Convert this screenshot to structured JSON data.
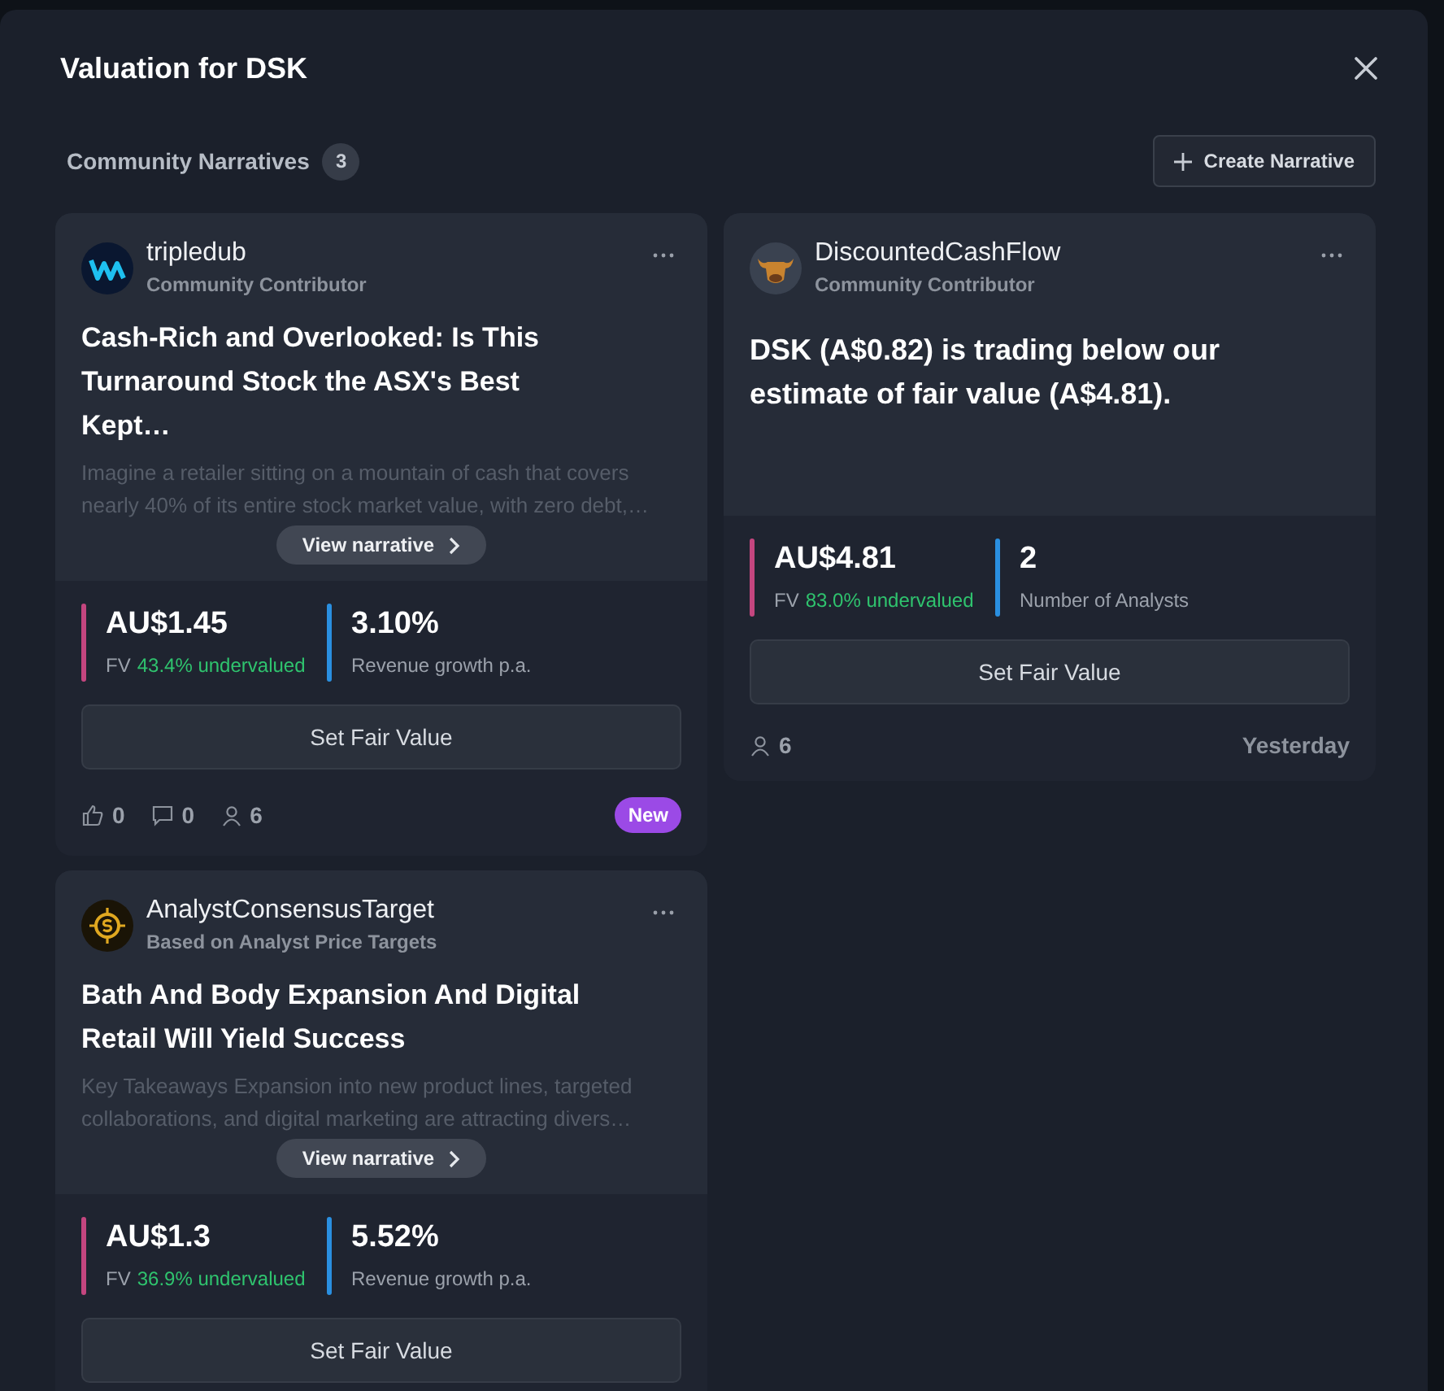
{
  "modal": {
    "title": "Valuation for DSK"
  },
  "section": {
    "title": "Community Narratives",
    "count": "3",
    "create_button": "Create Narrative"
  },
  "narratives": [
    {
      "kind": "wave",
      "author": "tripledub",
      "role": "Community Contributor",
      "title": "Cash-Rich and Overlooked: Is This Turnaround Stock the ASX's Best Kept…",
      "excerpt": "Imagine a retailer sitting on a mountain of cash that covers nearly 40% of its entire stock market value, with zero debt,…",
      "view_button": "View narrative",
      "metrics": [
        {
          "value": "AU$1.45",
          "label": "FV",
          "status": "43.4% undervalued",
          "color": "#c4467f"
        },
        {
          "value": "3.10%",
          "label": "Revenue growth p.a.",
          "color": "#2a8fe0"
        }
      ],
      "button": "Set Fair Value",
      "footer": {
        "likes": "0",
        "comments": "0",
        "followers": "6",
        "badge": "New"
      }
    },
    {
      "kind": "bull",
      "author": "DiscountedCashFlow",
      "role": "Community Contributor",
      "title": "DSK (A$0.82) is trading below our estimate of fair value (A$4.81).",
      "metrics": [
        {
          "value": "AU$4.81",
          "label": "FV",
          "status": "83.0% undervalued",
          "color": "#c4467f"
        },
        {
          "value": "2",
          "label": "Number of Analysts",
          "color": "#2a8fe0"
        }
      ],
      "button": "Set Fair Value",
      "footer": {
        "followers": "6",
        "date": "Yesterday"
      }
    },
    {
      "kind": "target",
      "author": "AnalystConsensusTarget",
      "role": "Based on Analyst Price Targets",
      "title": "Bath And Body Expansion And Digital Retail Will Yield Success",
      "excerpt": "Key Takeaways Expansion into new product lines, targeted collaborations, and digital marketing are attracting divers…",
      "view_button": "View narrative",
      "metrics": [
        {
          "value": "AU$1.3",
          "label": "FV",
          "status": "36.9% undervalued",
          "color": "#c4467f"
        },
        {
          "value": "5.52%",
          "label": "Revenue growth p.a.",
          "color": "#2a8fe0"
        }
      ],
      "button": "Set Fair Value"
    }
  ]
}
